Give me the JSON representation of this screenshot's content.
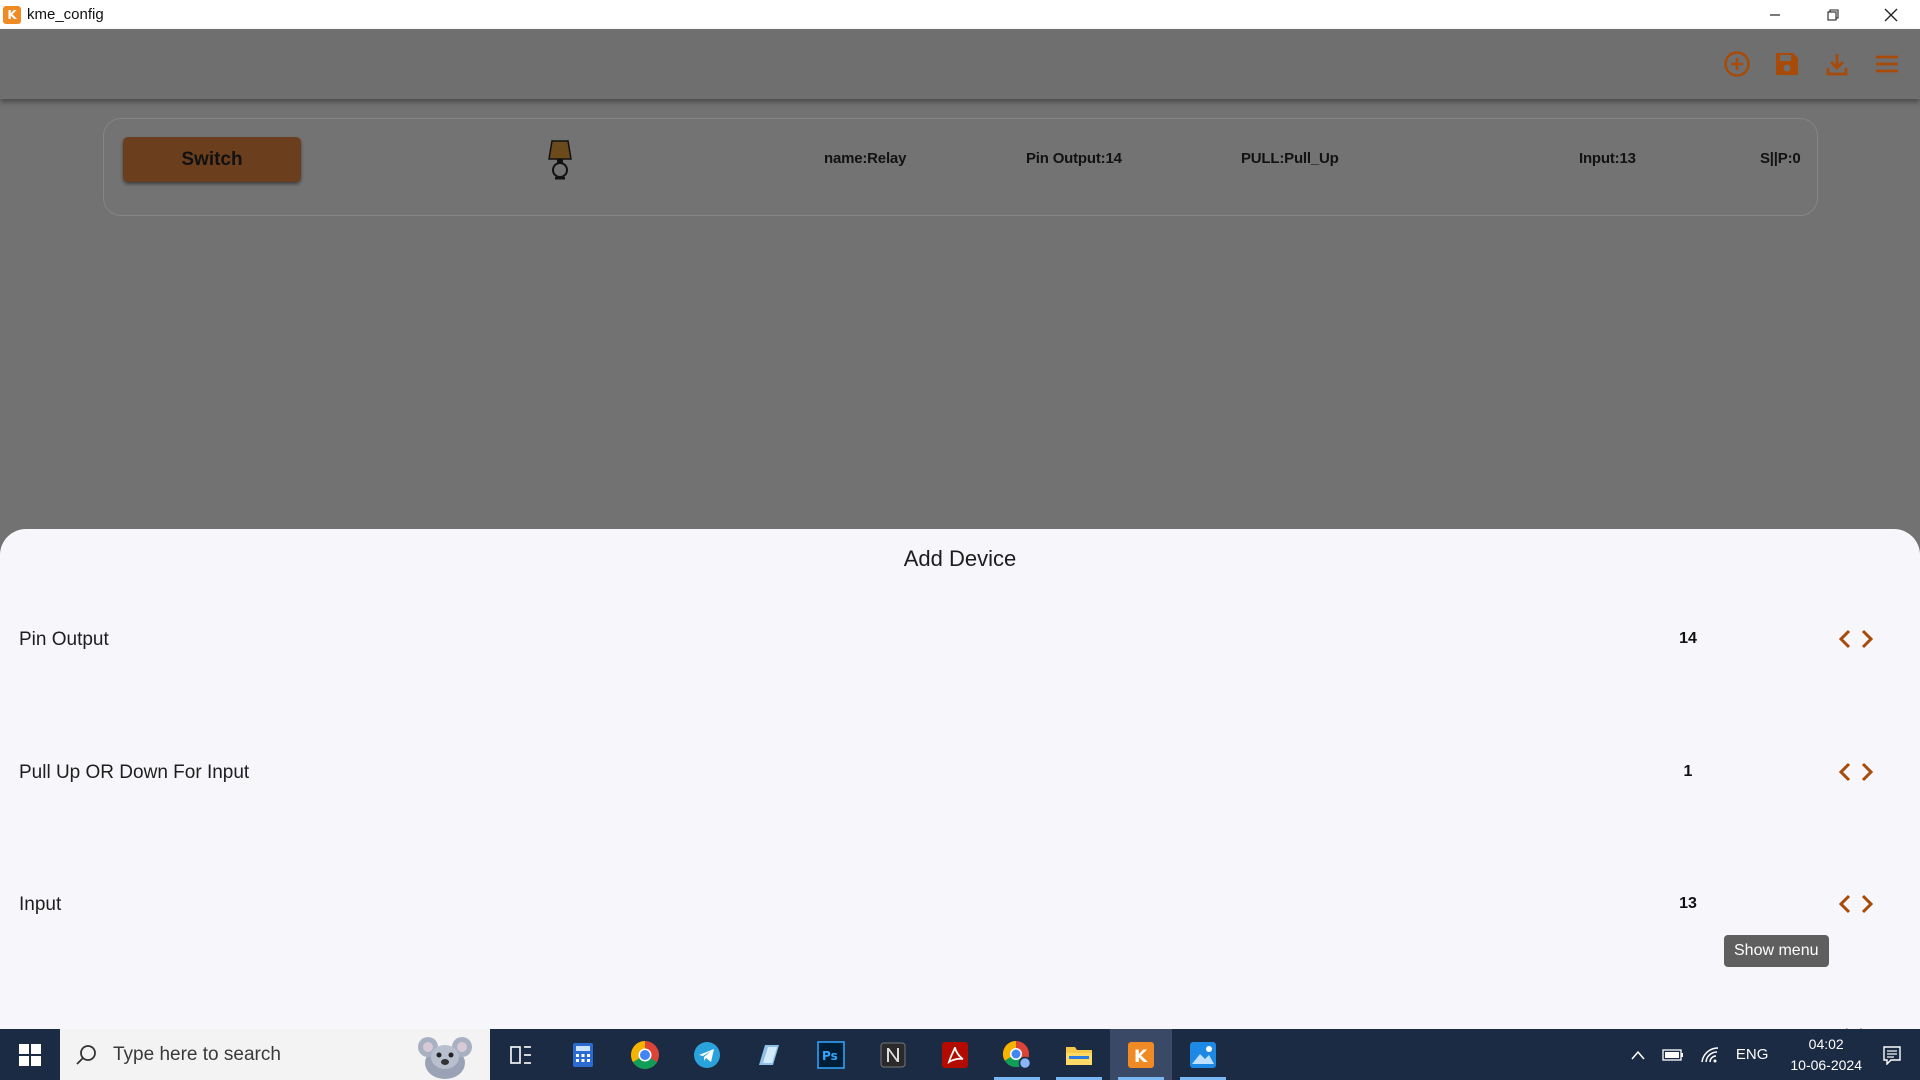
{
  "window": {
    "title": "kme_config",
    "logo_letter": "K",
    "controls": [
      "minimize-icon",
      "restore-icon",
      "close-icon"
    ]
  },
  "appbar": {
    "actions": [
      {
        "name": "add-device-icon",
        "color": "#a84a08"
      },
      {
        "name": "save-icon",
        "color": "#a84a08"
      },
      {
        "name": "download-icon",
        "color": "#a84a08"
      },
      {
        "name": "menu-icon",
        "color": "#a84a08"
      }
    ]
  },
  "device_card": {
    "button_label": "Switch",
    "icon": "lamp-icon",
    "fields": {
      "name": "name:Relay",
      "pin_output": "Pin Output:14",
      "pull": "PULL:Pull_Up",
      "input": "Input:13",
      "sip": "S||P:0"
    }
  },
  "sheet": {
    "title": "Add Device",
    "rows": [
      {
        "label": "Pin Output",
        "value": "14"
      },
      {
        "label": "Pull Up OR Down For Input",
        "value": "1"
      },
      {
        "label": "Input",
        "value": "13"
      }
    ],
    "tooltip": "Show menu"
  },
  "taskbar": {
    "search_placeholder": "Type here to search",
    "apps": [
      "task-view-icon",
      "calculator-icon",
      "chrome-icon",
      "telegram-icon",
      "notepad-app-icon",
      "photoshop-icon",
      "notion-icon",
      "acrobat-icon",
      "chrome-profile-icon",
      "file-explorer-icon",
      "kme-config-icon",
      "photos-icon"
    ],
    "tray": {
      "language": "ENG",
      "time": "04:02",
      "date": "10-06-2024"
    }
  },
  "colors": {
    "accent": "#a84a08",
    "switch_button": "#6b3f1d",
    "taskbar": "#1c2b44"
  }
}
